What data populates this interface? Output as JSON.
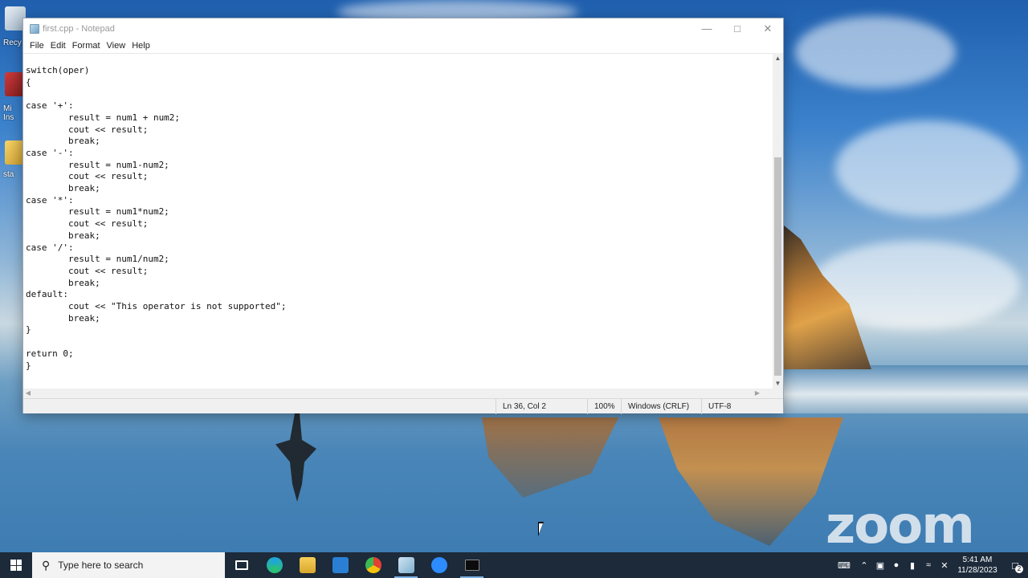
{
  "window": {
    "title": "first.cpp - Notepad",
    "menu": [
      "File",
      "Edit",
      "Format",
      "View",
      "Help"
    ]
  },
  "editor": {
    "lines": [
      "switch(oper)",
      "{",
      "",
      "case '+':",
      "        result = num1 + num2;",
      "        cout << result;",
      "        break;",
      "case '-':",
      "        result = num1-num2;",
      "        cout << result;",
      "        break;",
      "case '*':",
      "        result = num1*num2;",
      "        cout << result;",
      "        break;",
      "case '/':",
      "        result = num1/num2;",
      "        cout << result;",
      "        break;",
      "default:",
      "        cout << \"This operator is not supported\";",
      "        break;",
      "}",
      "",
      "return 0;",
      "}"
    ]
  },
  "statusbar": {
    "position": "Ln 36, Col 2",
    "zoom": "100%",
    "line_ending": "Windows (CRLF)",
    "encoding": "UTF-8"
  },
  "desktop": {
    "icon_labels": [
      "Recy",
      "Mi\nIns",
      "sta"
    ]
  },
  "watermark": "zoom",
  "taskbar": {
    "search_placeholder": "Type here to search",
    "clock_time": "5:41 AM",
    "clock_date": "11/28/2023",
    "notification_count": "2",
    "apps": [
      "task-view-icon",
      "edge-icon",
      "file-explorer-icon",
      "mail-icon",
      "chrome-icon",
      "notepad-icon",
      "zoom-icon",
      "terminal-icon"
    ]
  },
  "colors": {
    "taskbar": "#1c2a3a",
    "chrome": "#f0f0f0",
    "text": "#111111"
  }
}
